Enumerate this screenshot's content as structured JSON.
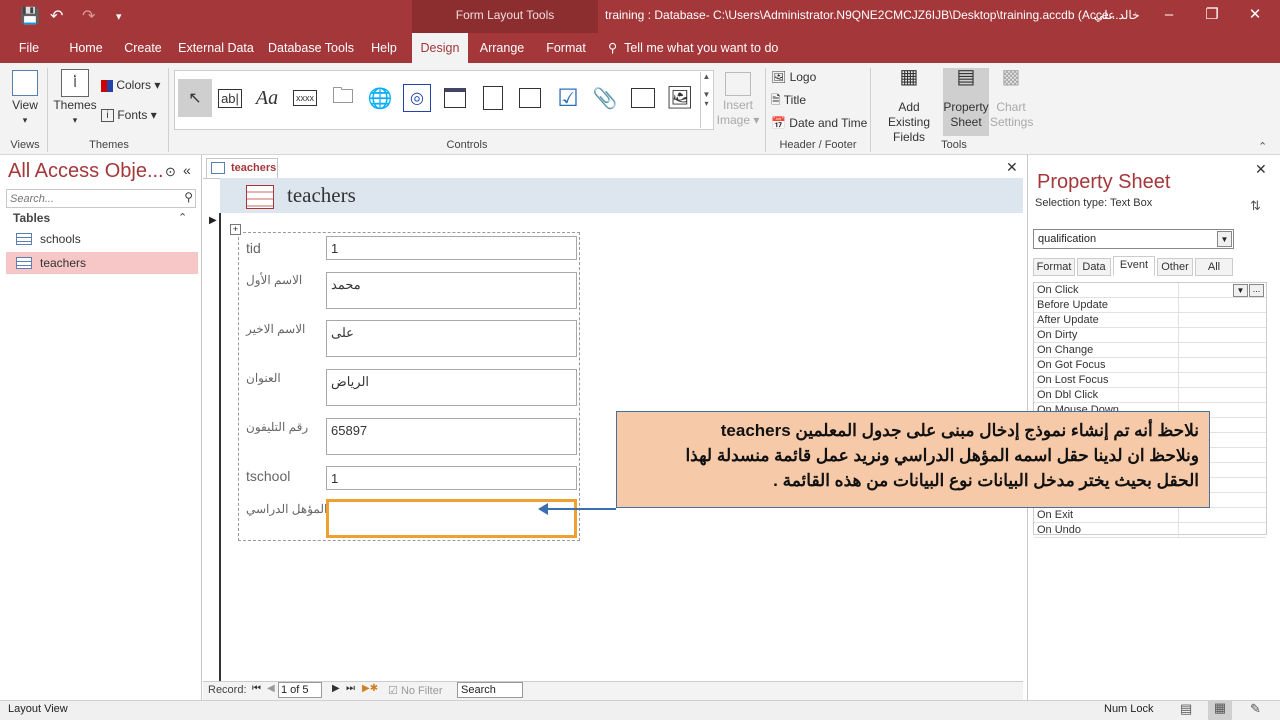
{
  "window": {
    "context_tab": "Form Layout Tools",
    "title": "training : Database- C:\\Users\\Administrator.N9QNE2CMCJZ6IJB\\Desktop\\training.accdb (Acce...",
    "user": "خالد علي"
  },
  "ribbon_tabs": [
    "File",
    "Home",
    "Create",
    "External Data",
    "Database Tools",
    "Help",
    "Design",
    "Arrange",
    "Format"
  ],
  "active_tab": "Design",
  "tell_me": "Tell me what you want to do",
  "ribbon": {
    "view": "View",
    "themes": "Themes",
    "colors": "Colors",
    "fonts": "Fonts",
    "insert_image": [
      "Insert",
      "Image"
    ],
    "logo": "Logo",
    "title": "Title",
    "date_time": "Date and Time",
    "add_fields": [
      "Add Existing",
      "Fields"
    ],
    "property_sheet": [
      "Property",
      "Sheet"
    ],
    "chart_settings": [
      "Chart",
      "Settings"
    ],
    "groups": {
      "views": "Views",
      "themes": "Themes",
      "controls": "Controls",
      "header_footer": "Header / Footer",
      "tools": "Tools"
    }
  },
  "nav": {
    "title": "All Access Obje...",
    "search_placeholder": "Search...",
    "section": "Tables",
    "items": [
      "schools",
      "teachers"
    ]
  },
  "document": {
    "tab": "teachers",
    "form_title": "teachers",
    "fields": [
      {
        "label": "tid",
        "value": "1"
      },
      {
        "label": "الاسم الأول",
        "value": "محمد"
      },
      {
        "label": "الاسم الاخير",
        "value": "على"
      },
      {
        "label": "العنوان",
        "value": "الرياض"
      },
      {
        "label": "رقم التليفون",
        "value": "65897"
      },
      {
        "label": "tschool",
        "value": "1"
      },
      {
        "label": "المؤهل الدراسي",
        "value": ""
      }
    ]
  },
  "record_nav": {
    "label": "Record:",
    "position": "1 of 5",
    "filter": "No Filter",
    "search": "Search"
  },
  "property_sheet": {
    "title": "Property Sheet",
    "selection": "Selection type:  Text Box",
    "object": "qualification",
    "tabs": [
      "Format",
      "Data",
      "Event",
      "Other",
      "All"
    ],
    "active_tab": "Event",
    "rows": [
      "On Click",
      "Before Update",
      "After Update",
      "On Dirty",
      "On Change",
      "On Got Focus",
      "On Lost Focus",
      "On Dbl Click",
      "On Mouse Down",
      "",
      "",
      "",
      "",
      "",
      "",
      "On Exit",
      "On Undo"
    ]
  },
  "callout": {
    "lines": [
      "نلاحظ أنه تم إنشاء نموذج إدخال مبنى على جدول المعلمين teachers",
      "ونلاحظ ان لدينا حقل اسمه المؤهل الدراسي ونريد عمل قائمة منسدلة لهذا",
      "الحقل بحيث يختر مدخل البيانات نوع البيانات من هذه القائمة ."
    ]
  },
  "status": {
    "mode": "Layout View",
    "numlock": "Num Lock"
  }
}
